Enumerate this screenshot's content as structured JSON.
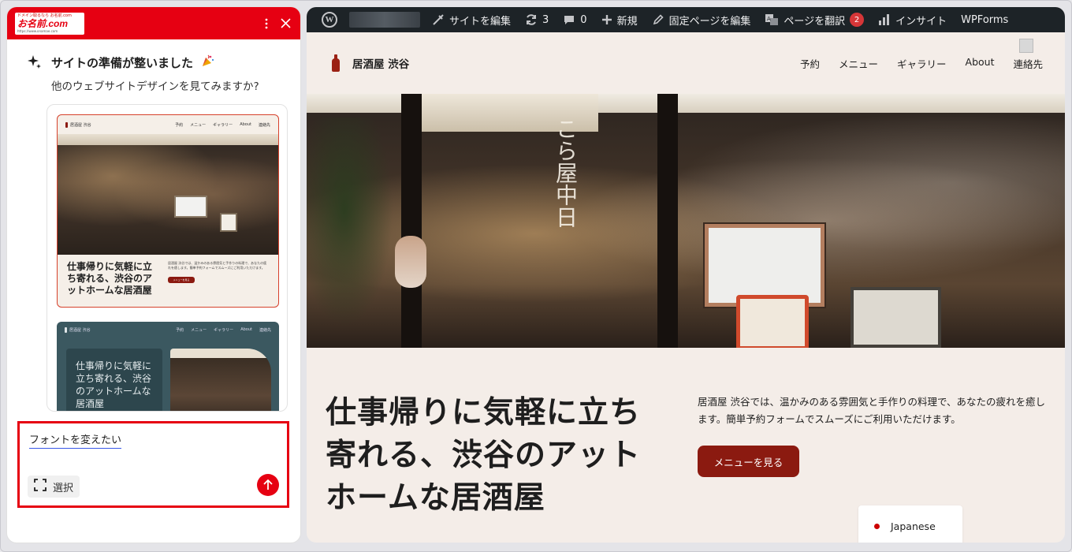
{
  "panel": {
    "logo": {
      "tagline": "ドメイン取るなら お名前.com",
      "brand": "お名前.com",
      "url": "https://www.onamae.com"
    },
    "message": {
      "title": "サイトの準備が整いました",
      "subtitle": "他のウェブサイトデザインを見てみますか?"
    },
    "card1": {
      "site_title": "居酒屋 渋谷",
      "nav": [
        "予約",
        "メニュー",
        "ギャラリー",
        "About",
        "連絡先"
      ],
      "heading": "仕事帰りに気軽に立ち寄れる、渋谷のアットホームな居酒屋",
      "desc": "居酒屋 渋谷では、温かみのある雰囲気と手作りの料理で、あなたの疲れを癒します。簡単予約フォームでスムーズにご利用いただけます。",
      "button": "メニューを見る"
    },
    "card2": {
      "site_title": "居酒屋 渋谷",
      "nav": [
        "予約",
        "メニュー",
        "ギャラリー",
        "About",
        "連絡先"
      ],
      "heading": "仕事帰りに気軽に立ち寄れる、渋谷のアットホームな居酒屋"
    },
    "input": {
      "value": "フォントを変えたい",
      "select_label": "選択"
    }
  },
  "adminbar": {
    "edit_site": "サイトを編集",
    "updates_count": "3",
    "comments_count": "0",
    "new": "新規",
    "edit_page": "固定ページを編集",
    "translate": "ページを翻訳",
    "translate_badge": "2",
    "insights": "インサイト",
    "wpforms": "WPForms"
  },
  "site": {
    "title": "居酒屋 渋谷",
    "nav": {
      "reserve": "予約",
      "menu": "メニュー",
      "gallery": "ギャラリー",
      "about": "About",
      "contact": "連絡先"
    },
    "hero_sign": "こら屋中日",
    "hero_heading": "仕事帰りに気軽に立ち寄れる、渋谷のアットホームな居酒屋",
    "hero_desc": "居酒屋 渋谷では、温かみのある雰囲気と手作りの料理で、あなたの疲れを癒します。簡単予約フォームでスムーズにご利用いただけます。",
    "cta": "メニューを見る",
    "language": "Japanese"
  },
  "colors": {
    "brand_red": "#e60012",
    "cta_brown": "#8b1a10",
    "admin_bar": "#1d2327",
    "site_bg": "#f4ede8"
  }
}
